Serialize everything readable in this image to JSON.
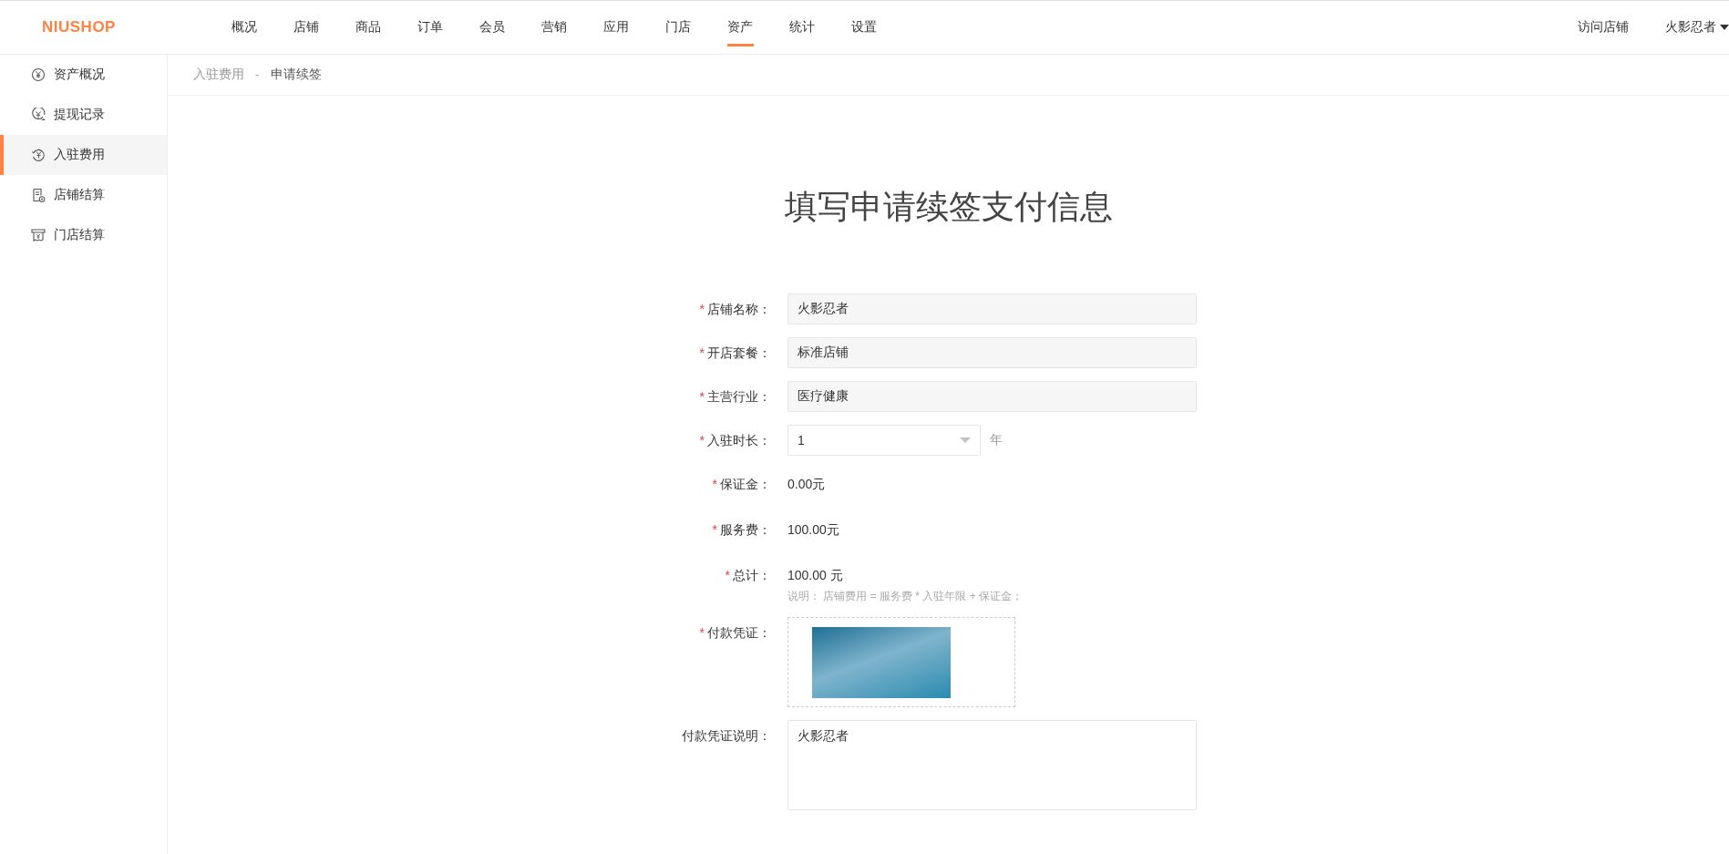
{
  "header": {
    "logo": "NIUSHOP",
    "nav": [
      {
        "label": "概况",
        "selected": false
      },
      {
        "label": "店铺",
        "selected": false
      },
      {
        "label": "商品",
        "selected": false
      },
      {
        "label": "订单",
        "selected": false
      },
      {
        "label": "会员",
        "selected": false
      },
      {
        "label": "营销",
        "selected": false
      },
      {
        "label": "应用",
        "selected": false
      },
      {
        "label": "门店",
        "selected": false
      },
      {
        "label": "资产",
        "selected": true
      },
      {
        "label": "统计",
        "selected": false
      },
      {
        "label": "设置",
        "selected": false
      }
    ],
    "visit_store": "访问店铺",
    "user": "火影忍者"
  },
  "sidebar": {
    "items": [
      {
        "label": "资产概况",
        "selected": false
      },
      {
        "label": "提现记录",
        "selected": false
      },
      {
        "label": "入驻费用",
        "selected": true
      },
      {
        "label": "店铺结算",
        "selected": false
      },
      {
        "label": "门店结算",
        "selected": false
      }
    ]
  },
  "breadcrumb": {
    "separator": "-",
    "items": [
      "入驻费用",
      "申请续签"
    ]
  },
  "form": {
    "title": "填写申请续签支付信息",
    "required_mark": "*",
    "rows": [
      {
        "kind": "input",
        "label": "店铺名称：",
        "required": true,
        "value": "火影忍者"
      },
      {
        "kind": "input",
        "label": "开店套餐：",
        "required": true,
        "value": "标准店铺"
      },
      {
        "kind": "input",
        "label": "主营行业：",
        "required": true,
        "value": "医疗健康"
      },
      {
        "kind": "select",
        "label": "入驻时长：",
        "required": true,
        "value": "1",
        "unit": "年"
      },
      {
        "kind": "text",
        "label": "保证金：",
        "required": true,
        "value": "0.00元"
      },
      {
        "kind": "text",
        "label": "服务费：",
        "required": true,
        "value": "100.00元"
      },
      {
        "kind": "text",
        "label": "总计：",
        "required": true,
        "value": "100.00 元",
        "note": "说明：  店铺费用 = 服务费 * 入驻年限 + 保证金；"
      },
      {
        "kind": "upload",
        "label": "付款凭证：",
        "required": true
      },
      {
        "kind": "textarea",
        "label": "付款凭证说明：",
        "required": false,
        "value": "火影忍者"
      }
    ]
  }
}
